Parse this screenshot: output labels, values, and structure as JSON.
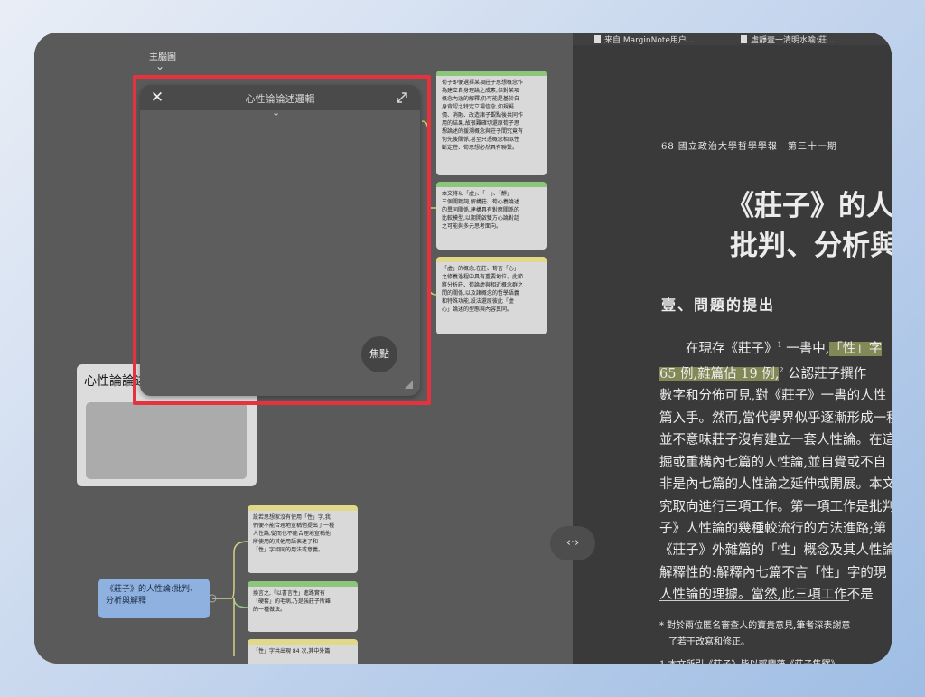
{
  "mindmap": {
    "label": "主腦圖"
  },
  "popup": {
    "title": "心性論論述邏輯",
    "focus_label": "焦點"
  },
  "cards_top": [
    {
      "text": "荀子即便選擇某項莊子思想概念作\n為建立自身理論之成素,但對某項\n概念內涵的解釋,仍可能是基於自\n身背認之特定立場信念,如規擬\n價、消融、改造諸子觀點後共同作\n用的結果,故很難確切還原荀子思\n想論述的援溯概念與莊子間究竟有\n何先後關係,甚至只憑概念相似性\n斷定莊、荀思想必然具有聯繫。"
    },
    {
      "text": "本文將以「虛」、「一」、「靜」\n三個關鍵詞,解構莊、荀心養論述\n的異同關係,建構具有對應關係的\n比較模型,以期開啟雙方心論對話\n之可能與多元思考面向。"
    },
    {
      "text": "「虛」的概念,在莊、荀言「心」\n之修養過程中具有重要地位。此節\n將分析莊、荀論虛與相近概念群之\n間的關係,以及諸概念的哲學語義\n和特殊功能,設法還原彼此「虛\n心」論述的型態與內容異同。"
    }
  ],
  "node_box": {
    "title": "心性論論述"
  },
  "root_node": {
    "label": "《莊子》的人性論:批判、分析與解釋"
  },
  "cards_bottom": [
    {
      "text": "設若思想家沒有使用「性」字,我\n們便不能合理地宣稱他提出了一種\n人性論,從而也不能合理地宣稱他\n所使用的其他用語表述了和\n「性」字相同的用法或意義。"
    },
    {
      "text": "換言之,「以書言性」進路實有\n「硬套」的毛病,乃是強莊子所難\n的一種做法。"
    },
    {
      "text": "「性」字共出現 84 次,其中外篇"
    }
  ],
  "center_toggle": "‹·›",
  "reader": {
    "tabs": [
      "来自 MarginNote用户...",
      "虛靜壹一清明水喻:莊..."
    ],
    "journal_line": "68 國立政治大學哲學學報　第三十一期",
    "title_lines": [
      "《莊子》的人",
      "批判、分析與"
    ],
    "section_heading": "壹、問題的提出",
    "para_line1_pre": "在現存《莊子》",
    "para_line1_sup": "1",
    "para_line1_mid": " 一書中,",
    "para_line1_hl": "「性」字",
    "para_line2_hl": "65 例,雜篇佔 19 例,",
    "para_line2_sup": "2",
    "para_line2_rest": " 公認莊子撰作",
    "para_lines": [
      "數字和分佈可見,對《莊子》一書的人性",
      "篇入手。然而,當代學界似乎逐漸形成一種",
      "並不意味莊子沒有建立一套人性論。在這",
      "掘或重構內七篇的人性論,並自覺或不自",
      "非是內七篇的人性論之延伸或開展。本文",
      "究取向進行三項工作。第一項工作是批判",
      "子》人性論的幾種較流行的方法進路;第",
      "《莊子》外雜篇的「性」概念及其人性論",
      "解釋性的:解釋內七篇不言「性」字的現",
      "人性論的理據。當然,此三項工作不是"
    ],
    "footnote_line1": "* 對於兩位匿名審查人的寶貴意見,筆者深表謝意",
    "footnote_line2": "　了若干改寫和修正。",
    "footnote_line3": "1 本文所引《莊子》皆以郭慶藩《莊子集釋》"
  }
}
